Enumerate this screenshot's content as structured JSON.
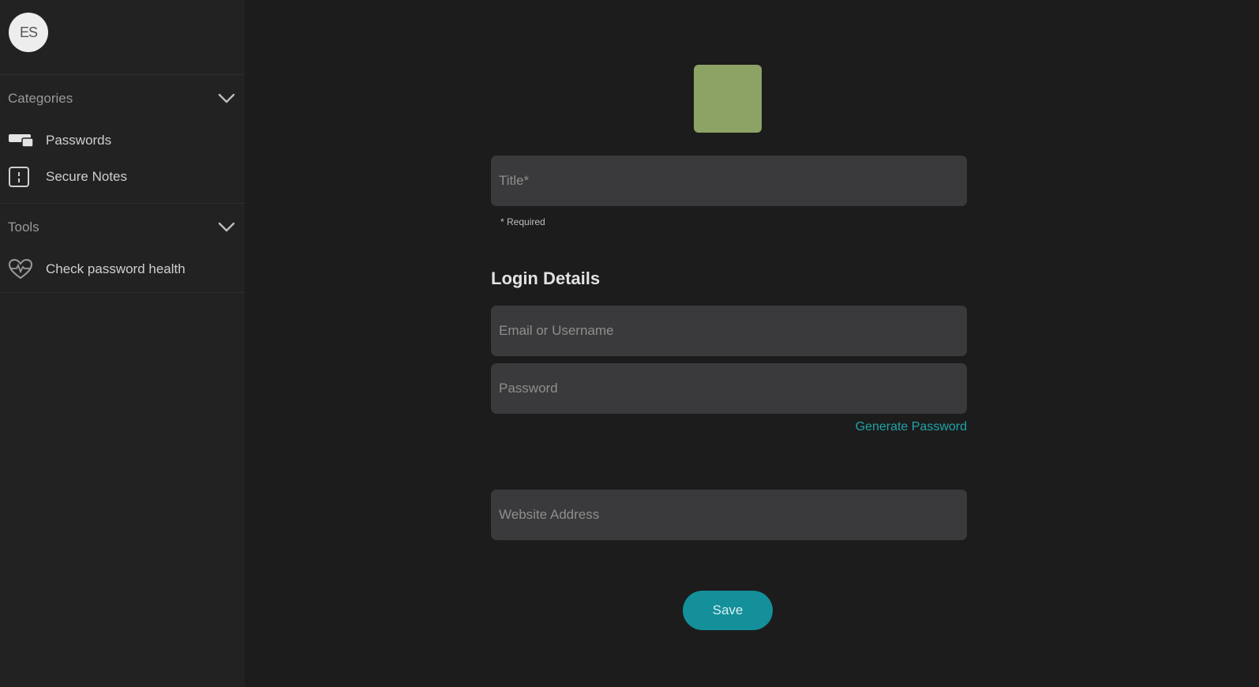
{
  "user": {
    "initials": "ES"
  },
  "sidebar": {
    "categories": {
      "title": "Categories",
      "items": [
        {
          "label": "Passwords",
          "icon": "credit-card-icon"
        },
        {
          "label": "Secure Notes",
          "icon": "note-icon"
        }
      ]
    },
    "tools": {
      "title": "Tools",
      "items": [
        {
          "label": "Check password health",
          "icon": "heartbeat-icon"
        }
      ]
    }
  },
  "form": {
    "icon_color": "#8da366",
    "title_placeholder": "Title*",
    "required_note": "* Required",
    "login_heading": "Login Details",
    "username_placeholder": "Email or Username",
    "password_placeholder": "Password",
    "generate_password_label": "Generate Password",
    "website_placeholder": "Website Address",
    "save_label": "Save"
  },
  "colors": {
    "accent": "#13909a",
    "link": "#1fa3a8",
    "background": "#1c1c1c",
    "sidebar": "#222222",
    "field": "#3a3a3c"
  }
}
